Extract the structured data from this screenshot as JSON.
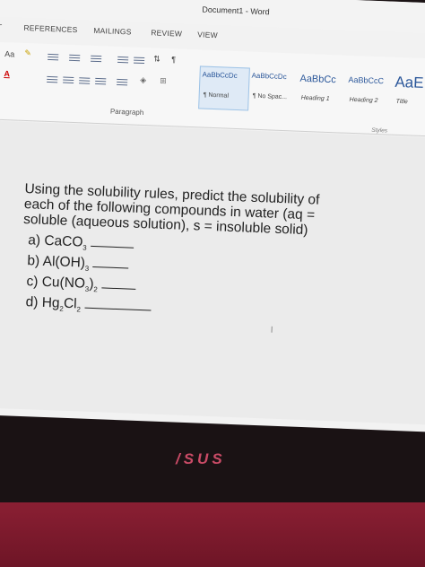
{
  "window": {
    "title": "Document1 - Word"
  },
  "tabs": [
    "IT",
    "REFERENCES",
    "MAILINGS",
    "REVIEW",
    "VIEW"
  ],
  "ribbon": {
    "font_size_btn": "Aa",
    "paragraph_group": "Paragraph",
    "styles_group": "Styles",
    "styles": [
      {
        "sample": "AaBbCcDc",
        "name": "¶ Normal"
      },
      {
        "sample": "AaBbCcDc",
        "name": "¶ No Spac..."
      },
      {
        "sample": "AaBbCc",
        "name": "Heading 1"
      },
      {
        "sample": "AaBbCcC",
        "name": "Heading 2"
      },
      {
        "sample": "AaE",
        "name": "Title"
      }
    ]
  },
  "document": {
    "question_lines": [
      "Using the solubility rules, predict the solubility of",
      "each of the following compounds in water (aq =",
      "soluble (aqueous solution), s = insoluble solid)"
    ],
    "items": [
      {
        "label": "a) CaCO",
        "sub": "3"
      },
      {
        "label": "b) Al(OH)",
        "sub": "3"
      },
      {
        "label": "c) Cu(NO",
        "sub": "3",
        "tail": ")",
        "sub2": "2"
      },
      {
        "label": "d) Hg",
        "sub": "2",
        "tail": "Cl",
        "sub2": "2"
      }
    ],
    "cursor": "I"
  },
  "laptop": {
    "logo": "/SUS"
  },
  "colors": {
    "accent": "#2b579a",
    "bezel": "#8a1f33"
  }
}
